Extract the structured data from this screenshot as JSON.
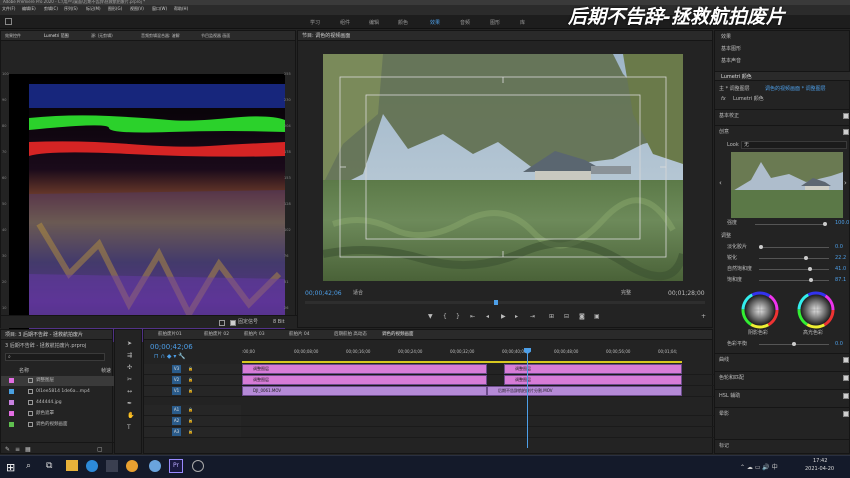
{
  "app": {
    "title": "Adobe Premiere Pro 2020 - C:\\用户\\\\桌面\\后期不告辞\\拯救航拍废片.prproj *",
    "menu": [
      "文件(F)",
      "编辑(E)",
      "剪辑(C)",
      "序列(S)",
      "标记(M)",
      "图形(G)",
      "视图(V)",
      "窗口(W)",
      "帮助(H)"
    ],
    "workspaces": [
      "学习",
      "组件",
      "编辑",
      "颜色",
      "效果",
      "音频",
      "图形",
      "库"
    ],
    "active_workspace": "效果",
    "watermark": "后期不告辞-拯救航拍废片"
  },
  "scopes_panel": {
    "tabs": [
      "效果控件",
      "Lumetri 范围",
      "源: (无剪辑)",
      "音频剪辑混合器: 溶解",
      "节目监视器 画面"
    ],
    "active_tab": "Lumetri 范围",
    "left_ticks": [
      "100",
      "90",
      "80",
      "70",
      "60",
      "50",
      "40",
      "30",
      "20",
      "10",
      "0"
    ],
    "right_ticks": [
      "255",
      "230",
      "204",
      "178",
      "153",
      "128",
      "102",
      "76",
      "51",
      "26",
      "0"
    ],
    "footer_value": "8 Bit",
    "footer_check_label": "固定信号"
  },
  "program_monitor": {
    "tab": "节目: 调色的视频画面",
    "timecode_left": "00;00;42;06",
    "fit_label": "适合",
    "quality_label": "完整",
    "timecode_right": "00;01;28;00"
  },
  "lumetri": {
    "top_tabs": [
      "效果",
      "基本图形",
      "基本声音",
      "Lumetri 颜色"
    ],
    "master_label": "主 * 调整图层",
    "master_seq": "调色的视频画面 * 调整图层",
    "fx_label": "Lumetri 颜色",
    "basic_correction": "基本校正",
    "creative": "创意",
    "look_label": "Look",
    "look_value": "无",
    "intensity_label": "强度",
    "intensity_value": "100.0",
    "adjust_label": "调整",
    "faded_film_label": "淡化胶片",
    "faded_film_value": "0.0",
    "sharpen_label": "锐化",
    "sharpen_value": "22.2",
    "vibrance_label": "自然饱和度",
    "vibrance_value": "41.0",
    "saturation_label": "饱和度",
    "saturation_value": "87.1",
    "shadow_tint_label": "阴影色彩",
    "highlight_tint_label": "高光色彩",
    "tint_balance_label": "色彩平衡",
    "tint_balance_value": "0.0",
    "sections": [
      "曲线",
      "色轮和匹配",
      "HSL 辅助",
      "晕影"
    ],
    "bottom_tab": "标记"
  },
  "project": {
    "tab": "项目: 3 后期不告辞 - 拯救航拍废片",
    "tab2": "媒体浏览器",
    "file_name": "3 后期不告辞 - 拯救航拍废片.prproj",
    "search_placeholder": "",
    "col_name": "名称",
    "col_rate": "帧速",
    "items": [
      {
        "name": "调整图层",
        "color": "#e26de2"
      },
      {
        "name": "0l1ee5814  1de6a...mp4",
        "color": "#4aa0e0"
      },
      {
        "name": "444444.jpg",
        "color": "#c882e0"
      },
      {
        "name": "颜色遮罩",
        "color": "#e26de2"
      },
      {
        "name": "调色的视频画面",
        "color": "#5fbf4f"
      }
    ]
  },
  "timeline": {
    "tabs": [
      "航拍废片01",
      "航拍废片 02",
      "航拍片 03",
      "航拍片 04",
      "后期航拍 高动态",
      "调色的视频画面"
    ],
    "active_tab": "调色的视频画面",
    "timecode": "00;00;42;06",
    "ruler": [
      ":00;00",
      "00;00;08;00",
      "00;00;16;00",
      "00;00;24;00",
      "00;00;32;00",
      "00;00;40;00",
      "00;00;48;00",
      "00;00;56;00",
      "00;01;04;"
    ],
    "video_tracks": [
      "V3",
      "V2",
      "V1"
    ],
    "audio_tracks": [
      "A1",
      "A2",
      "A3"
    ],
    "clips": {
      "v3a": "调整图层",
      "v3b": "调整图层",
      "v2a": "调整图层",
      "v2b": "调整图层",
      "v1a": "DJI_0061.MOV",
      "v1b": "后期不告辞航拍废片分割.MOV"
    }
  },
  "taskbar": {
    "time": "17:42",
    "date": "2021-04-20"
  }
}
